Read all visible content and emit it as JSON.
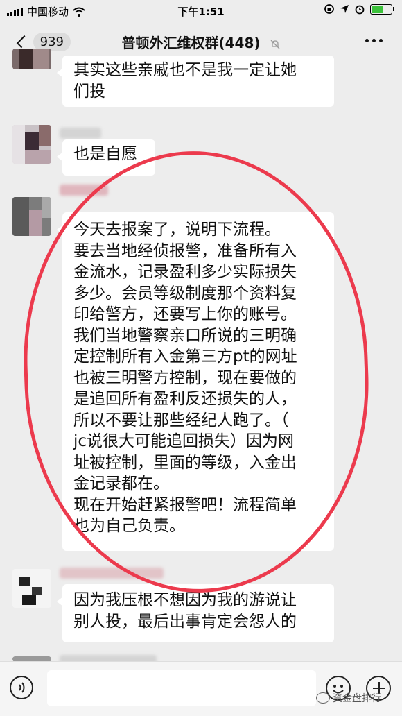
{
  "status_bar": {
    "carrier": "中国移动",
    "time": "下午1:51"
  },
  "nav": {
    "back_count": "939",
    "title": "普顿外汇维权群(448)"
  },
  "messages": [
    {
      "lines": [
        "其实这些亲戚也不是我一定让她",
        "们投"
      ]
    },
    {
      "lines": [
        "也是自愿"
      ]
    },
    {
      "lines": [
        "今天去报案了，说明下流程。",
        "要去当地经侦报警，准备所有入",
        "金流水，记录盈利多少实际损失",
        "多少。会员等级制度那个资料复",
        "印给警方，还要写上你的账号。",
        "我们当地警察亲口所说的三明确",
        "定控制所有入金第三方pt的网址",
        "也被三明警方控制，现在要做的",
        "是追回所有盈利反还损失的人，",
        "所以不要让那些经纪人跑了。（",
        "jc说很大可能追回损失）因为网",
        "址被控制，里面的等级，入金出",
        "金记录都在。",
        "现在开始赶紧报警吧！流程简单",
        "也为自己负责。"
      ]
    },
    {
      "lines": [
        "因为我压根不想因为我的游说让",
        "别人投，最后出事肯定会怨人的"
      ]
    }
  ],
  "watermark": {
    "text": "资金盘排行"
  },
  "colors": {
    "background": "#ededed",
    "annotation": "#ec3a4d",
    "battery": "#3cc13b"
  },
  "icons": [
    "signal-icon",
    "wifi-icon",
    "lock-rotation-icon",
    "location-icon",
    "alarm-icon",
    "battery-icon",
    "back-chevron-icon",
    "mute-bell-icon",
    "more-icon",
    "voice-icon",
    "emoji-icon",
    "plus-icon"
  ]
}
